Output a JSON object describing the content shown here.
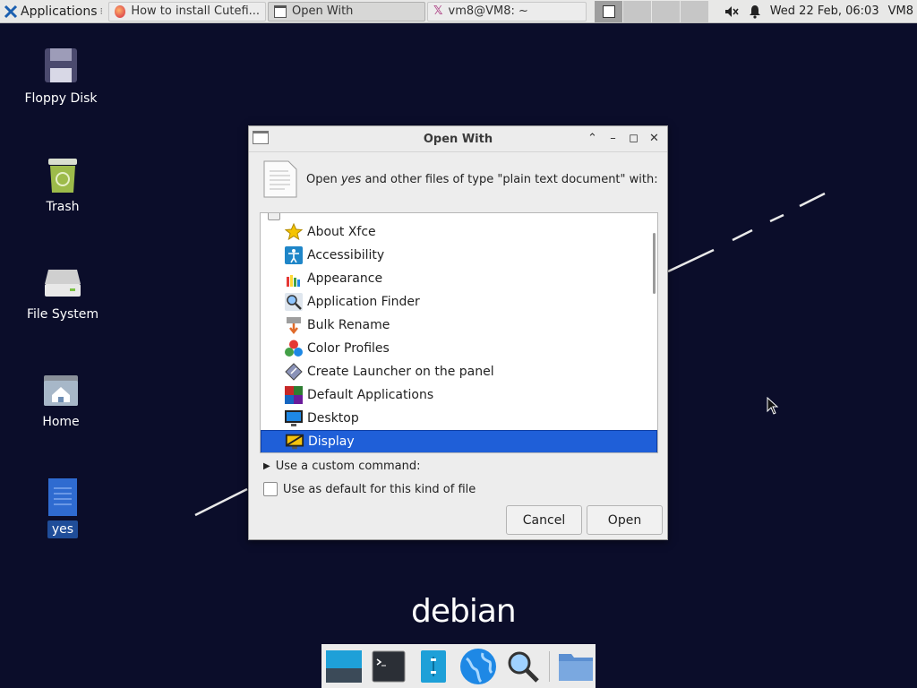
{
  "panel": {
    "applications_label": "Applications",
    "tasks": [
      {
        "label": "How to install Cutefi..."
      },
      {
        "label": "Open With"
      },
      {
        "label": "vm8@VM8: ~"
      }
    ],
    "clock": "Wed 22 Feb, 06:03",
    "user": "VM8"
  },
  "desktop": {
    "icons": [
      {
        "label": "Floppy Disk"
      },
      {
        "label": "Trash"
      },
      {
        "label": "File System"
      },
      {
        "label": "Home"
      },
      {
        "label": "yes"
      }
    ],
    "branding": "debian"
  },
  "dialog": {
    "title": "Open With",
    "prompt_pre": "Open ",
    "prompt_file": "yes",
    "prompt_post": " and other files of type \"plain text document\" with:",
    "apps": [
      {
        "label": "About Xfce"
      },
      {
        "label": "Accessibility"
      },
      {
        "label": "Appearance"
      },
      {
        "label": "Application Finder"
      },
      {
        "label": "Bulk Rename"
      },
      {
        "label": "Color Profiles"
      },
      {
        "label": "Create Launcher on the panel"
      },
      {
        "label": "Default Applications"
      },
      {
        "label": "Desktop"
      },
      {
        "label": "Display"
      }
    ],
    "selected_app": "Display",
    "custom_command_label": "Use a custom command:",
    "default_checkbox_label": "Use as default for this kind of file",
    "cancel_label": "Cancel",
    "open_label": "Open"
  },
  "colors": {
    "desktop_bg": "#0b0d2a",
    "selection": "#1f5fd8"
  }
}
